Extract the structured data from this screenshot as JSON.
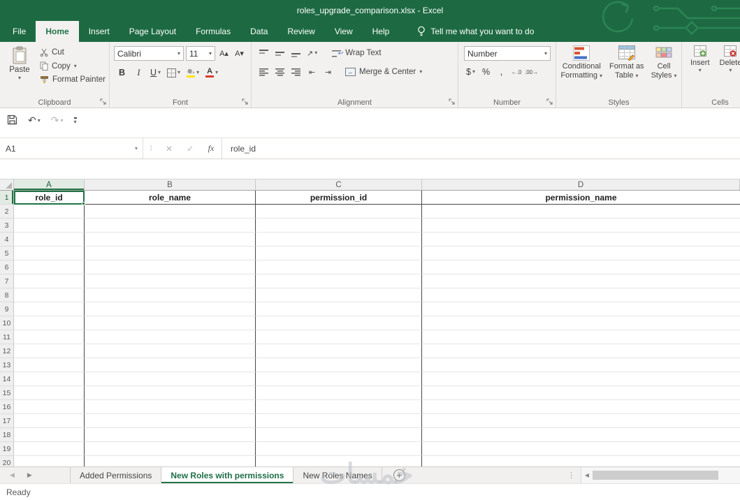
{
  "colors": {
    "accent_green": "#217346",
    "titlebar_green": "#1d6a42",
    "ribbon_background": "#f2f1f0",
    "selection_border": "#1f7245"
  },
  "title_bar": {
    "title": "roles_upgrade_comparison.xlsx  -  Excel"
  },
  "menu": {
    "tabs": [
      "File",
      "Home",
      "Insert",
      "Page Layout",
      "Formulas",
      "Data",
      "Review",
      "View",
      "Help"
    ],
    "active_tab": "Home",
    "tell_me": "Tell me what you want to do"
  },
  "ribbon": {
    "clipboard": {
      "label": "Clipboard",
      "paste": "Paste",
      "cut": "Cut",
      "copy": "Copy",
      "format_painter": "Format Painter"
    },
    "font": {
      "label": "Font",
      "family": "Calibri",
      "size": "11",
      "bold": "B",
      "italic": "I",
      "underline": "U"
    },
    "alignment": {
      "label": "Alignment",
      "wrap_text": "Wrap Text",
      "merge_center": "Merge & Center"
    },
    "number": {
      "label": "Number",
      "format": "Number",
      "currency": "$",
      "percent": "%",
      "comma": ","
    },
    "styles": {
      "label": "Styles",
      "conditional_1": "Conditional",
      "conditional_2": "Formatting",
      "table_1": "Format as",
      "table_2": "Table",
      "cell_1": "Cell",
      "cell_2": "Styles"
    },
    "cells": {
      "label": "Cells",
      "insert": "Insert",
      "delete": "Delete"
    }
  },
  "formula_bar": {
    "name_box": "A1",
    "fx": "fx",
    "content": "role_id"
  },
  "grid": {
    "selected_cell": "A1",
    "columns": [
      "A",
      "B",
      "C",
      "D"
    ],
    "row_count": 20,
    "header_row": [
      "role_id",
      "role_name",
      "permission_id",
      "permission_name"
    ]
  },
  "sheet_tabs": {
    "tabs": [
      {
        "label": "Added Permissions",
        "active": false
      },
      {
        "label": "New Roles with permissions",
        "active": true
      },
      {
        "label": "New Roles Names",
        "active": false
      }
    ]
  },
  "status_bar": {
    "status": "Ready"
  },
  "watermark": "خمسات",
  "icons": {
    "dropdown": "▾",
    "grow_font": "A▴",
    "shrink_font": "A▾",
    "orientation": "↗",
    "indent_decrease": "⇤",
    "indent_increase": "⇥",
    "wrap_return": "↩",
    "merge_arrows": "↔",
    "increase_decimal": "←.0",
    "decrease_decimal": ".00→",
    "font_color_letter": "A",
    "cancel": "✕",
    "enter": "✓",
    "grip_dots": "⁞",
    "splitter": "⋮",
    "undo": "↶",
    "redo": "↷",
    "nav_prev": "◀",
    "nav_next": "▶",
    "scroll_left": "◀",
    "add_sheet": "+"
  }
}
